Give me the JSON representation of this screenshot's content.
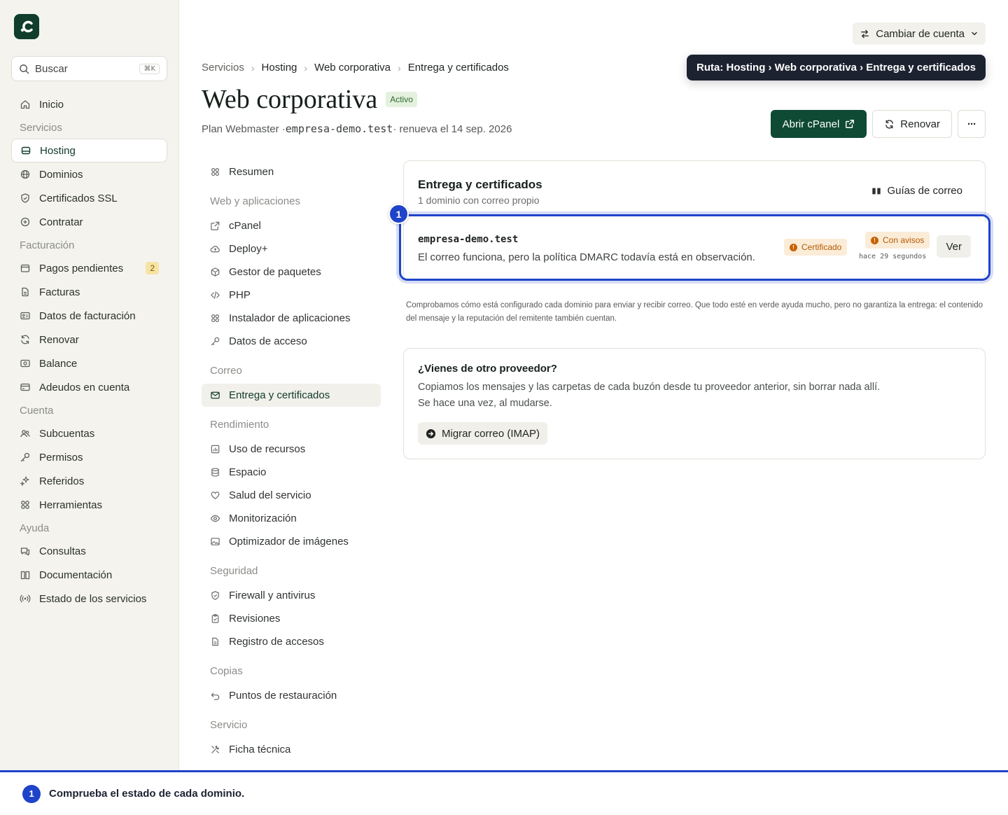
{
  "sidebar": {
    "logo_letter": "c",
    "search": {
      "placeholder": "Buscar",
      "shortcut": "⌘K"
    },
    "items": [
      {
        "type": "item",
        "label": "Inicio",
        "icon": "home-icon"
      },
      {
        "type": "section",
        "label": "Servicios"
      },
      {
        "type": "item",
        "label": "Hosting",
        "icon": "server-icon",
        "active": true
      },
      {
        "type": "item",
        "label": "Dominios",
        "icon": "globe-icon"
      },
      {
        "type": "item",
        "label": "Certificados SSL",
        "icon": "shield-icon"
      },
      {
        "type": "item",
        "label": "Contratar",
        "icon": "plus-circle-icon"
      },
      {
        "type": "section",
        "label": "Facturación"
      },
      {
        "type": "item",
        "label": "Pagos pendientes",
        "icon": "wallet-icon",
        "count": "2"
      },
      {
        "type": "item",
        "label": "Facturas",
        "icon": "document-icon"
      },
      {
        "type": "item",
        "label": "Datos de facturación",
        "icon": "id-card-icon"
      },
      {
        "type": "item",
        "label": "Renovar",
        "icon": "refresh-icon"
      },
      {
        "type": "item",
        "label": "Balance",
        "icon": "banknote-icon"
      },
      {
        "type": "item",
        "label": "Adeudos en cuenta",
        "icon": "credit-card-icon"
      },
      {
        "type": "section",
        "label": "Cuenta"
      },
      {
        "type": "item",
        "label": "Subcuentas",
        "icon": "users-icon"
      },
      {
        "type": "item",
        "label": "Permisos",
        "icon": "key-icon"
      },
      {
        "type": "item",
        "label": "Referidos",
        "icon": "sparkles-icon"
      },
      {
        "type": "item",
        "label": "Herramientas",
        "icon": "grid-icon"
      },
      {
        "type": "section",
        "label": "Ayuda"
      },
      {
        "type": "item",
        "label": "Consultas",
        "icon": "chat-icon"
      },
      {
        "type": "item",
        "label": "Documentación",
        "icon": "book-icon"
      },
      {
        "type": "item",
        "label": "Estado de los servicios",
        "icon": "broadcast-icon"
      }
    ]
  },
  "header": {
    "switch_account": "Cambiar de cuenta",
    "tooltip": "Ruta: Hosting › Web corporativa › Entrega y certificados",
    "breadcrumb": [
      "Servicios",
      "Hosting",
      "Web corporativa",
      "Entrega y certificados"
    ],
    "title": "Web corporativa",
    "status": "Activo",
    "subtitle": {
      "plan": "Plan Webmaster",
      "sep": "·",
      "domain": "empresa-demo.test",
      "renewal": "renueva el 14 sep. 2026"
    },
    "actions": {
      "open_cpanel": "Abrir cPanel",
      "renew": "Renovar",
      "more": "···"
    }
  },
  "subnav": [
    {
      "type": "item",
      "label": "Resumen",
      "icon": "grid-icon"
    },
    {
      "type": "section",
      "label": "Web y aplicaciones"
    },
    {
      "type": "item",
      "label": "cPanel",
      "icon": "external-link-icon"
    },
    {
      "type": "item",
      "label": "Deploy+",
      "icon": "cloud-upload-icon"
    },
    {
      "type": "item",
      "label": "Gestor de paquetes",
      "icon": "package-icon"
    },
    {
      "type": "item",
      "label": "PHP",
      "icon": "code-icon"
    },
    {
      "type": "item",
      "label": "Instalador de aplicaciones",
      "icon": "grid-icon"
    },
    {
      "type": "item",
      "label": "Datos de acceso",
      "icon": "key-icon"
    },
    {
      "type": "section",
      "label": "Correo"
    },
    {
      "type": "item",
      "label": "Entrega y certificados",
      "icon": "mail-icon",
      "active": true
    },
    {
      "type": "section",
      "label": "Rendimiento"
    },
    {
      "type": "item",
      "label": "Uso de recursos",
      "icon": "chart-icon"
    },
    {
      "type": "item",
      "label": "Espacio",
      "icon": "database-icon"
    },
    {
      "type": "item",
      "label": "Salud del servicio",
      "icon": "heart-icon"
    },
    {
      "type": "item",
      "label": "Monitorización",
      "icon": "eye-icon"
    },
    {
      "type": "item",
      "label": "Optimizador de imágenes",
      "icon": "image-icon"
    },
    {
      "type": "section",
      "label": "Seguridad"
    },
    {
      "type": "item",
      "label": "Firewall y antivirus",
      "icon": "shield-icon"
    },
    {
      "type": "item",
      "label": "Revisiones",
      "icon": "clipboard-icon"
    },
    {
      "type": "item",
      "label": "Registro de accesos",
      "icon": "document-icon"
    },
    {
      "type": "section",
      "label": "Copias"
    },
    {
      "type": "item",
      "label": "Puntos de restauración",
      "icon": "undo-icon"
    },
    {
      "type": "section",
      "label": "Servicio"
    },
    {
      "type": "item",
      "label": "Ficha técnica",
      "icon": "tools-icon"
    }
  ],
  "delivery": {
    "title": "Entrega y certificados",
    "subtitle": "1 dominio con correo propio",
    "guides_link": "Guías de correo",
    "domain": {
      "name": "empresa-demo.test",
      "description": "El correo funciona, pero la política DMARC todavía está en observación.",
      "cert_badge": "Certificado",
      "status_badge": "Con avisos",
      "checked": "hace 29 segundos",
      "view_button": "Ver"
    },
    "note": "Comprobamos cómo está configurado cada dominio para enviar y recibir correo. Que todo esté en verde ayuda mucho, pero no garantiza la entrega: el contenido del mensaje y la reputación del remitente también cuentan."
  },
  "migrate": {
    "title": "¿Vienes de otro proveedor?",
    "description": "Copiamos los mensajes y las carpetas de cada buzón desde tu proveedor anterior, sin borrar nada allí. Se hace una vez, al mudarse.",
    "button": "Migrar correo (IMAP)"
  },
  "guide": {
    "step": "1",
    "text": "Comprueba el estado de cada dominio."
  },
  "colors": {
    "brand": "#0f4a34",
    "highlight": "#1f43c9",
    "warning": "#c86200",
    "tooltip_bg": "#1c2230"
  }
}
